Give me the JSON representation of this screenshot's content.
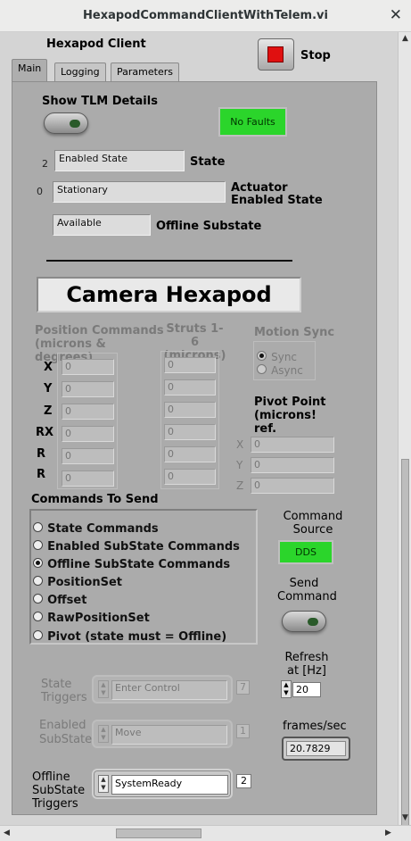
{
  "window": {
    "title": "HexapodCommandClientWithTelem.vi",
    "close_glyph": "✕"
  },
  "header": {
    "client_label": "Hexapod Client",
    "stop_label": "Stop"
  },
  "tabs": [
    "Main",
    "Logging",
    "Parameters"
  ],
  "tlm": {
    "label": "Show TLM Details"
  },
  "faults": {
    "label": "No Faults"
  },
  "state": {
    "index": "2",
    "value": "Enabled State",
    "label": "State"
  },
  "actuator": {
    "index": "0",
    "value": "Stationary",
    "label": "Actuator Enabled State"
  },
  "offline": {
    "value": "Available",
    "label": "Offline Substate"
  },
  "title_banner": "Camera Hexapod",
  "position": {
    "heading": "Position Commands (microns & degrees)",
    "axes": [
      "X",
      "Y",
      "Z",
      "RX",
      "R",
      "R"
    ],
    "values": [
      "0",
      "0",
      "0",
      "0",
      "0",
      "0"
    ]
  },
  "struts": {
    "heading": "Struts 1-6 (microns)",
    "values": [
      "0",
      "0",
      "0",
      "0",
      "0",
      "0"
    ]
  },
  "motion_sync": {
    "heading": "Motion Sync",
    "options": [
      "Sync",
      "Async"
    ],
    "selected": "Sync"
  },
  "pivot": {
    "heading": "Pivot Point (microns! ref.",
    "axes": [
      "X",
      "Y",
      "Z"
    ],
    "values": [
      "0",
      "0",
      "0"
    ]
  },
  "commands": {
    "heading": "Commands To Send",
    "options": [
      "State Commands",
      "Enabled SubState Commands",
      "Offline SubState Commands",
      "PositionSet",
      "Offset",
      "RawPositionSet",
      "Pivot (state must = Offline)"
    ],
    "selected": "Offline SubState Commands"
  },
  "command_source": {
    "label": "Command Source",
    "value": "DDS"
  },
  "send_command": {
    "label": "Send Command"
  },
  "state_triggers": {
    "label": "State Triggers",
    "value": "Enter Control",
    "index": "7"
  },
  "enabled_triggers": {
    "label": "Enabled SubState",
    "value": "Move",
    "index": "1"
  },
  "offline_triggers": {
    "label": "Offline SubState Triggers",
    "value": "SystemReady",
    "index": "2"
  },
  "refresh": {
    "label": "Refresh at [Hz]",
    "value": "20"
  },
  "frames": {
    "label": "frames/sec",
    "value": "20.7829"
  },
  "colors": {
    "led_green": "#2bd52b",
    "stop_red": "#e01010",
    "panel": "#ababab"
  },
  "icons": {
    "stop": "stop-square-icon",
    "scroll_up": "arrow-up-icon",
    "scroll_down": "arrow-down-icon",
    "scroll_left": "arrow-left-icon",
    "scroll_right": "arrow-right-icon"
  }
}
